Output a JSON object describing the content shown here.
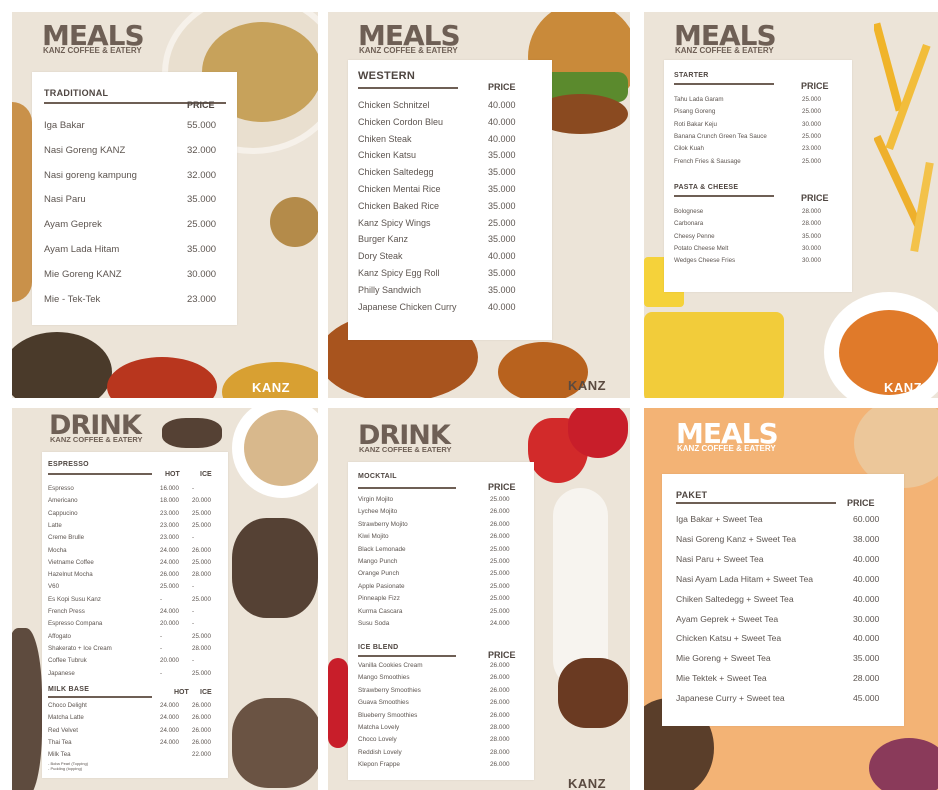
{
  "panel1": {
    "title": "MEALS",
    "subtitle": "KANZ COFFEE & EATERY",
    "section": "TRADITIONAL",
    "price_header": "PRICE",
    "items": [
      {
        "name": "Iga Bakar",
        "price": "55.000"
      },
      {
        "name": "Nasi Goreng KANZ",
        "price": "32.000"
      },
      {
        "name": "Nasi goreng kampung",
        "price": "32.000"
      },
      {
        "name": "Nasi Paru",
        "price": "35.000"
      },
      {
        "name": "Ayam Geprek",
        "price": "25.000"
      },
      {
        "name": "Ayam Lada Hitam",
        "price": "35.000"
      },
      {
        "name": "Mie Goreng KANZ",
        "price": "30.000"
      },
      {
        "name": "Mie - Tek-Tek",
        "price": "23.000"
      }
    ],
    "brand": "KANZ"
  },
  "panel2": {
    "title": "MEALS",
    "subtitle": "KANZ COFFEE & EATERY",
    "section": "WESTERN",
    "price_header": "PRICE",
    "items": [
      {
        "name": "Chicken Schnitzel",
        "price": "40.000"
      },
      {
        "name": "Chicken Cordon Bleu",
        "price": "40.000"
      },
      {
        "name": "Chiken Steak",
        "price": "40.000"
      },
      {
        "name": "Chicken Katsu",
        "price": "35.000"
      },
      {
        "name": "Chicken Saltedegg",
        "price": "35.000"
      },
      {
        "name": "Chicken Mentai Rice",
        "price": "35.000"
      },
      {
        "name": "Chicken Baked Rice",
        "price": "35.000"
      },
      {
        "name": "Kanz Spicy Wings",
        "price": "25.000"
      },
      {
        "name": "Burger Kanz",
        "price": "35.000"
      },
      {
        "name": "Dory Steak",
        "price": "40.000"
      },
      {
        "name": "Kanz Spicy Egg Roll",
        "price": "35.000"
      },
      {
        "name": "Philly Sandwich",
        "price": "35.000"
      },
      {
        "name": "Japanese Chicken Curry",
        "price": "40.000"
      }
    ],
    "brand": "KANZ"
  },
  "panel3": {
    "title": "MEALS",
    "subtitle": "KANZ COFFEE & EATERY",
    "section1": "STARTER",
    "price_header1": "PRICE",
    "starters": [
      {
        "name": "Tahu Lada Garam",
        "price": "25.000"
      },
      {
        "name": "Pisang Goreng",
        "price": "25.000"
      },
      {
        "name": "Roti Bakar Keju",
        "price": "30.000"
      },
      {
        "name": "Banana Crunch Green Tea Sauce",
        "price": "25.000"
      },
      {
        "name": "Cilok Kuah",
        "price": "23.000"
      },
      {
        "name": "French Fries & Sausage",
        "price": "25.000"
      }
    ],
    "section2": "PASTA & CHEESE",
    "price_header2": "PRICE",
    "pasta": [
      {
        "name": "Bolognese",
        "price": "28.000"
      },
      {
        "name": "Carbonara",
        "price": "28.000"
      },
      {
        "name": "Cheesy Penne",
        "price": "35.000"
      },
      {
        "name": "Potato Cheese Melt",
        "price": "30.000"
      },
      {
        "name": "Wedges Cheese Fries",
        "price": "30.000"
      }
    ],
    "brand": "KANZ"
  },
  "panel4": {
    "title": "DRINK",
    "subtitle": "KANZ COFFEE & EATERY",
    "section1": "ESPRESSO",
    "hot_header": "HOT",
    "ice_header": "ICE",
    "espresso": [
      {
        "name": "Espresso",
        "hot": "16.000",
        "ice": "-"
      },
      {
        "name": "Americano",
        "hot": "18.000",
        "ice": "20.000"
      },
      {
        "name": "Cappucino",
        "hot": "23.000",
        "ice": "25.000"
      },
      {
        "name": "Latte",
        "hot": "23.000",
        "ice": "25.000"
      },
      {
        "name": "Creme Brulle",
        "hot": "23.000",
        "ice": "-"
      },
      {
        "name": "Mocha",
        "hot": "24.000",
        "ice": "26.000"
      },
      {
        "name": "Vietname Coffee",
        "hot": "24.000",
        "ice": "25.000"
      },
      {
        "name": "Hazelnut Mocha",
        "hot": "26.000",
        "ice": "28.000"
      },
      {
        "name": "V60",
        "hot": "25.000",
        "ice": "-"
      },
      {
        "name": "Es Kopi Susu Kanz",
        "hot": "-",
        "ice": "25.000"
      },
      {
        "name": "French Press",
        "hot": "24.000",
        "ice": "-"
      },
      {
        "name": "Espresso Compana",
        "hot": "20.000",
        "ice": "-"
      },
      {
        "name": "Affogato",
        "hot": "-",
        "ice": "25.000"
      },
      {
        "name": "Shakerato + Ice Cream",
        "hot": "-",
        "ice": "28.000"
      },
      {
        "name": "Coffee Tubruk",
        "hot": "20.000",
        "ice": "-"
      },
      {
        "name": "Japanese",
        "hot": "-",
        "ice": "25.000"
      }
    ],
    "section2": "MILK BASE",
    "hot_header2": "HOT",
    "ice_header2": "ICE",
    "milk": [
      {
        "name": "Choco Delight",
        "hot": "24.000",
        "ice": "26.000"
      },
      {
        "name": "Matcha Latte",
        "hot": "24.000",
        "ice": "26.000"
      },
      {
        "name": "Red Velvet",
        "hot": "24.000",
        "ice": "26.000"
      },
      {
        "name": "Thai Tea",
        "hot": "24.000",
        "ice": "26.000"
      },
      {
        "name": "Milk Tea",
        "hot": "",
        "ice": "22.000"
      }
    ],
    "milk_tea_note1": "- Boba Pearl (Topping)",
    "milk_tea_note2": "- Pudding (topping)"
  },
  "panel5": {
    "title": "DRINK",
    "subtitle": "KANZ COFFEE & EATERY",
    "section1": "MOCKTAIL",
    "price_header1": "PRICE",
    "mocktail": [
      {
        "name": "Virgin Mojito",
        "price": "25.000"
      },
      {
        "name": "Lychee Mojito",
        "price": "26.000"
      },
      {
        "name": "Strawberry Mojito",
        "price": "26.000"
      },
      {
        "name": "Kiwi Mojito",
        "price": "26.000"
      },
      {
        "name": "Black Lemonade",
        "price": "25.000"
      },
      {
        "name": "Mango Punch",
        "price": "25.000"
      },
      {
        "name": "Orange Punch",
        "price": "25.000"
      },
      {
        "name": "Apple Pasionate",
        "price": "25.000"
      },
      {
        "name": "Pinneaple Fizz",
        "price": "25.000"
      },
      {
        "name": "Kurma Cascara",
        "price": "25.000"
      },
      {
        "name": "Susu Soda",
        "price": "24.000"
      }
    ],
    "section2": "ICE BLEND",
    "price_header2": "PRICE",
    "iceblend": [
      {
        "name": "Vanilla Cookies Cream",
        "price": "26.000"
      },
      {
        "name": "Mango Smoothies",
        "price": "26.000"
      },
      {
        "name": "Strawberry Smoothies",
        "price": "26.000"
      },
      {
        "name": "Guava Smoothies",
        "price": "26.000"
      },
      {
        "name": "Blueberry Smoothies",
        "price": "26.000"
      },
      {
        "name": "Matcha Lovely",
        "price": "28.000"
      },
      {
        "name": "Choco Lovely",
        "price": "28.000"
      },
      {
        "name": "Reddish Lovely",
        "price": "28.000"
      },
      {
        "name": "Klepon Frappe",
        "price": "26.000"
      }
    ],
    "brand": "KANZ"
  },
  "panel6": {
    "title": "MEALS",
    "subtitle": "KANZ COFFEE & EATERY",
    "section": "PAKET",
    "price_header": "PRICE",
    "items": [
      {
        "name": "Iga Bakar + Sweet Tea",
        "price": "60.000"
      },
      {
        "name": "Nasi Goreng Kanz + Sweet Tea",
        "price": "38.000"
      },
      {
        "name": "Nasi Paru + Sweet Tea",
        "price": "40.000"
      },
      {
        "name": "Nasi Ayam Lada Hitam + Sweet Tea",
        "price": "40.000"
      },
      {
        "name": "Chiken Saltedegg + Sweet Tea",
        "price": "40.000"
      },
      {
        "name": "Ayam Geprek + Sweet Tea",
        "price": "30.000"
      },
      {
        "name": "Chicken Katsu + Sweet Tea",
        "price": "40.000"
      },
      {
        "name": "Mie Goreng + Sweet Tea",
        "price": "35.000"
      },
      {
        "name": "Mie Tektek + Sweet Tea",
        "price": "28.000"
      },
      {
        "name": "Japanese Curry + Sweet tea",
        "price": "45.000"
      }
    ]
  }
}
